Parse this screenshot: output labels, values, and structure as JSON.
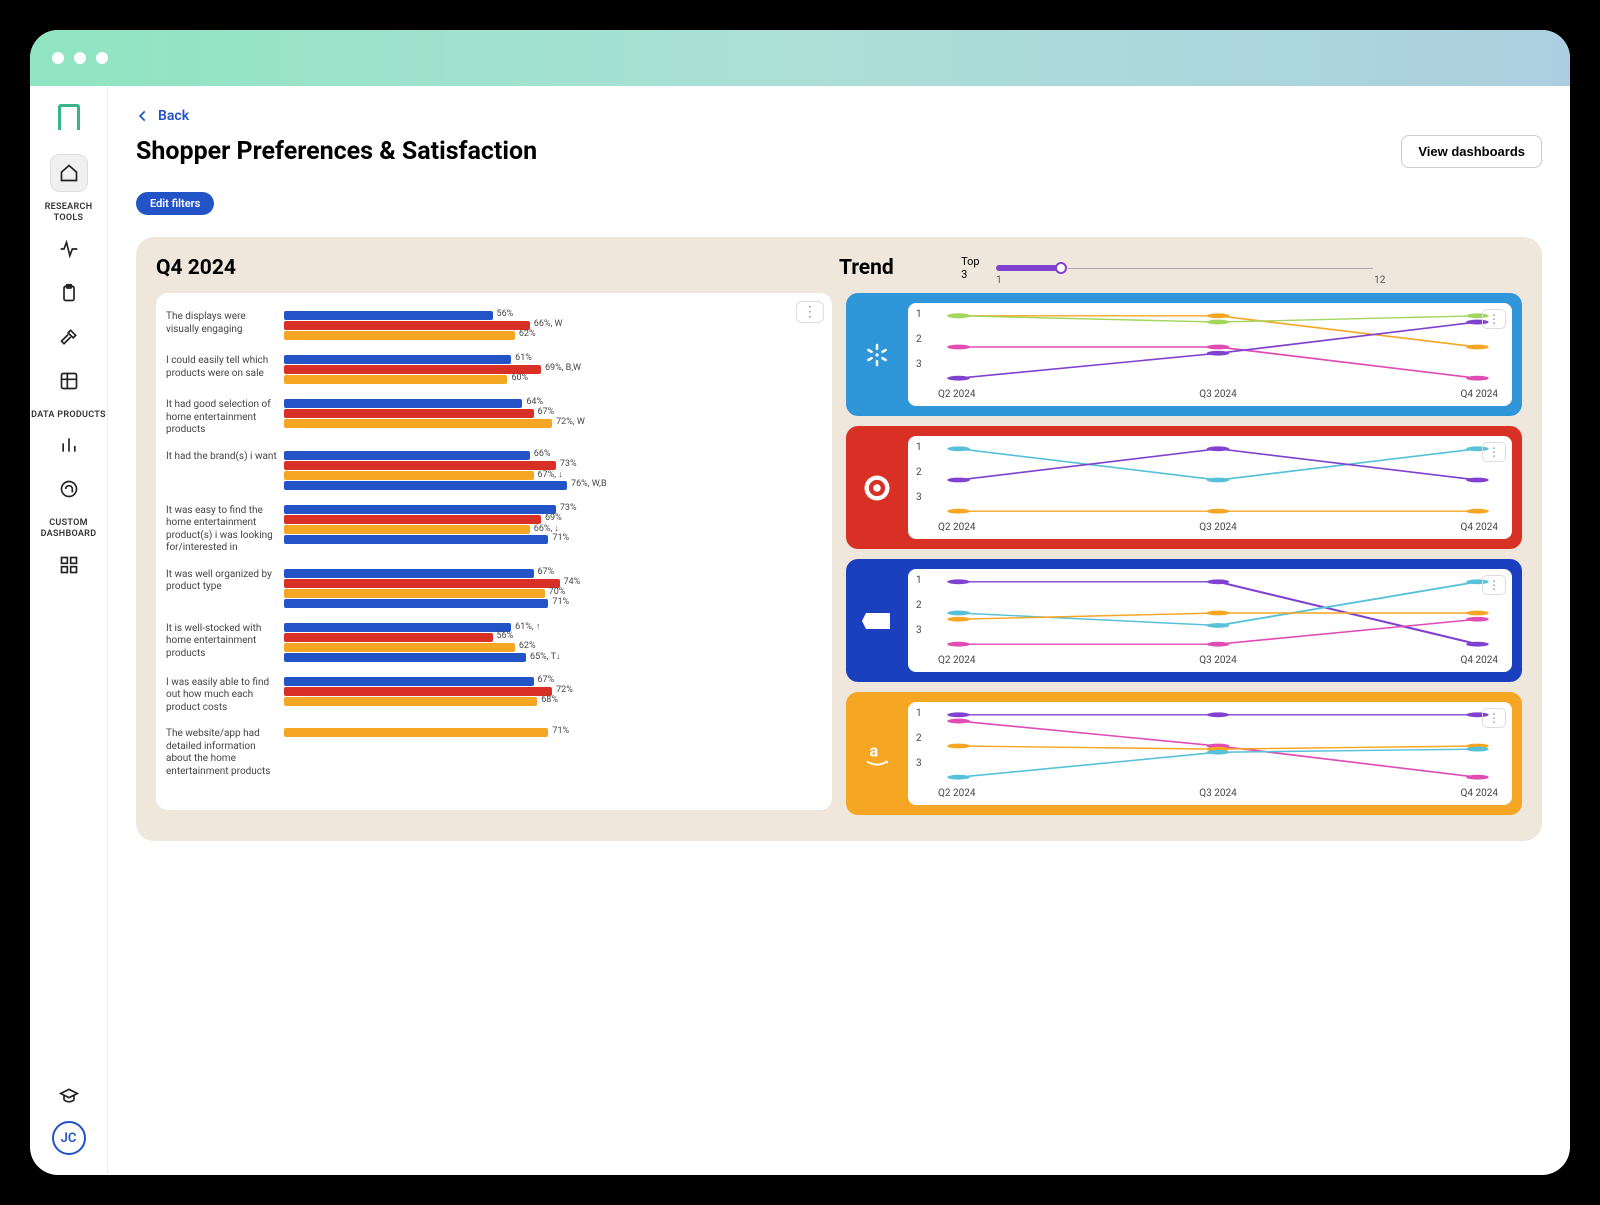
{
  "window": {
    "dots": 3
  },
  "sidebar": {
    "sections": [
      {
        "label": "RESEARCH\nTOOLS"
      },
      {
        "label": "DATA\nPRODUCTS"
      },
      {
        "label": "CUSTOM\nDASHBOARD"
      }
    ]
  },
  "user": {
    "initials": "JC"
  },
  "header": {
    "back_label": "Back",
    "title": "Shopper Preferences & Satisfaction",
    "view_btn": "View dashboards",
    "edit_filters": "Edit filters"
  },
  "panel": {
    "q_title": "Q4 2024",
    "trend_title": "Trend",
    "slider_label": "Top 3",
    "slider_min": "1",
    "slider_max": "12"
  },
  "colors": {
    "blue": "#2354c7",
    "red": "#d93025",
    "orange": "#f5a623",
    "walmart": "#2f97d9",
    "bestbuy": "#1a3fbf",
    "amazon": "#f5a623"
  },
  "chart_data": {
    "bar_chart": {
      "type": "bar",
      "title": "Q4 2024",
      "xlim": [
        0,
        100
      ],
      "series_colors": [
        "blue",
        "red",
        "orange"
      ],
      "rows": [
        {
          "label": "The displays were visually engaging",
          "values": [
            56,
            66,
            62
          ],
          "labels": [
            "56%",
            "66%, W",
            "62%"
          ]
        },
        {
          "label": "I could easily tell which products were on sale",
          "values": [
            61,
            69,
            60
          ],
          "labels": [
            "61%",
            "69%, B,W",
            "60%"
          ]
        },
        {
          "label": "It had good selection of home entertainment products",
          "values": [
            64,
            67,
            72
          ],
          "labels": [
            "64%",
            "67%",
            "72%, W"
          ]
        },
        {
          "label": "It had the brand(s) i want",
          "values": [
            66,
            73,
            67,
            76
          ],
          "labels": [
            "66%",
            "73%",
            "67%, ↓",
            "76%, W,B"
          ]
        },
        {
          "label": "It was easy to find the home entertainment product(s) i was looking for/interested in",
          "values": [
            73,
            69,
            66,
            71
          ],
          "labels": [
            "73%",
            "69%",
            "66%, ↓",
            "71%"
          ]
        },
        {
          "label": "It was well organized by product type",
          "values": [
            67,
            74,
            70,
            71
          ],
          "labels": [
            "67%",
            "74%",
            "70%",
            "71%"
          ]
        },
        {
          "label": "It is well-stocked with home entertainment products",
          "values": [
            61,
            56,
            62,
            65
          ],
          "labels": [
            "61%, ↑",
            "56%",
            "62%",
            "65%, T↓"
          ]
        },
        {
          "label": "I was easily able to find out how much each product costs",
          "values": [
            67,
            72,
            68
          ],
          "labels": [
            "67%",
            "72%",
            "68%"
          ]
        },
        {
          "label": "The website/app had detailed information about the home entertainment products",
          "values": [
            71
          ],
          "labels": [
            "71%"
          ],
          "colors": [
            "orange"
          ]
        }
      ]
    },
    "trend_charts": {
      "type": "line",
      "ylim": [
        3,
        1
      ],
      "yticks": [
        1,
        2,
        3
      ],
      "xlabels": [
        "Q2 2024",
        "Q3 2024",
        "Q4 2024"
      ],
      "brands": [
        {
          "name": "walmart",
          "bg": "bg-wal",
          "series": [
            {
              "color": "#f5a623",
              "ranks": [
                1,
                1,
                2
              ]
            },
            {
              "color": "#a3d65c",
              "ranks": [
                1,
                1.2,
                1
              ]
            },
            {
              "color": "#e04bb4",
              "ranks": [
                2,
                2,
                3
              ]
            },
            {
              "color": "#8040d0",
              "ranks": [
                3,
                2.2,
                1.2
              ]
            }
          ]
        },
        {
          "name": "target",
          "bg": "bg-tar",
          "series": [
            {
              "color": "#56c1d9",
              "ranks": [
                1,
                2,
                1
              ]
            },
            {
              "color": "#8040d0",
              "ranks": [
                2,
                1,
                2
              ]
            },
            {
              "color": "#f5a623",
              "ranks": [
                3,
                3,
                3
              ]
            }
          ]
        },
        {
          "name": "bestbuy",
          "bg": "bg-bb",
          "series": [
            {
              "color": "#8040d0",
              "ranks": [
                1,
                1,
                3
              ]
            },
            {
              "color": "#56c1d9",
              "ranks": [
                2,
                2.4,
                1
              ]
            },
            {
              "color": "#f5a623",
              "ranks": [
                2.2,
                2,
                2
              ]
            },
            {
              "color": "#e04bb4",
              "ranks": [
                3,
                3,
                2.2
              ]
            }
          ]
        },
        {
          "name": "amazon",
          "bg": "bg-amz",
          "series": [
            {
              "color": "#8040d0",
              "ranks": [
                1,
                1,
                1
              ]
            },
            {
              "color": "#e04bb4",
              "ranks": [
                1.2,
                2,
                3
              ]
            },
            {
              "color": "#f5a623",
              "ranks": [
                2,
                2.1,
                2
              ]
            },
            {
              "color": "#56c1d9",
              "ranks": [
                3,
                2.2,
                2.1
              ]
            }
          ]
        }
      ]
    }
  }
}
